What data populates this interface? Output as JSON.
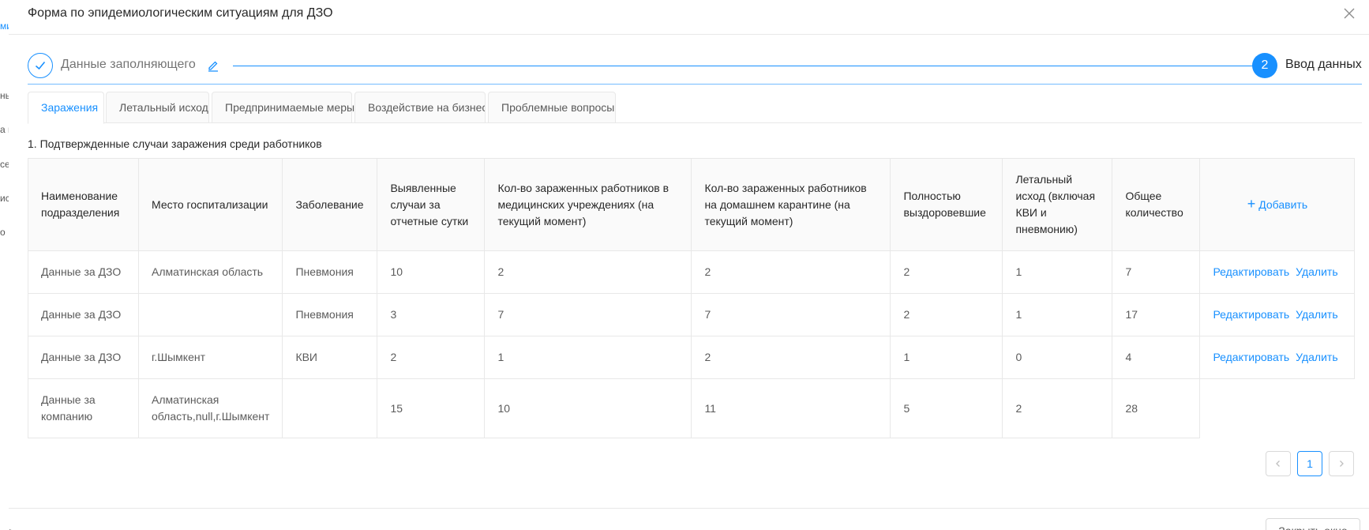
{
  "background_fragments": [
    "ми",
    "нь",
    "а п",
    "се",
    "ис",
    "о"
  ],
  "modal": {
    "title": "Форма по эпидемиологическим ситуациям для ДЗО",
    "close_icon": "close-icon"
  },
  "steps": [
    {
      "label": "Данные заполняющего",
      "status": "finished",
      "icon": "check-icon"
    },
    {
      "number": "2",
      "label": "Ввод данных",
      "status": "active"
    }
  ],
  "tabs": [
    {
      "label": "Заражения",
      "active": true
    },
    {
      "label": "Летальный исход",
      "active": false
    },
    {
      "label": "Предпринимаемые меры",
      "active": false
    },
    {
      "label": "Воздействие на бизнес",
      "active": false
    },
    {
      "label": "Проблемные вопросы",
      "active": false
    }
  ],
  "section_title": "1. Подтвержденные случаи заражения среди работников",
  "table": {
    "columns": [
      "Наименование подразделения",
      "Место госпитализации",
      "Заболевание",
      "Выявленные случаи за отчетные сутки",
      "Кол-во зараженных работников в медицинских учреждениях (на текущий момент)",
      "Кол-во зараженных работников на домашнем карантине (на текущий момент)",
      "Полностью выздоровевшие",
      "Летальный исход (включая КВИ и пневмонию)",
      "Общее количество"
    ],
    "add_label": "Добавить",
    "edit_label": "Редактировать",
    "delete_label": "Удалить",
    "rows": [
      [
        "Данные за ДЗО",
        "Алматинская область",
        "Пневмония",
        "10",
        "2",
        "2",
        "2",
        "1",
        "7"
      ],
      [
        "Данные за ДЗО",
        "",
        "Пневмония",
        "3",
        "7",
        "7",
        "2",
        "1",
        "17"
      ],
      [
        "Данные за ДЗО",
        "г.Шымкент",
        "КВИ",
        "2",
        "1",
        "2",
        "1",
        "0",
        "4"
      ]
    ],
    "total_row": [
      "Данные за компанию",
      "Алматинская область,null,г.Шымкент",
      "",
      "15",
      "10",
      "11",
      "5",
      "2",
      "28"
    ]
  },
  "pagination": {
    "current": "1"
  },
  "footer": {
    "close_button": "Закрыть окно"
  },
  "colors": {
    "accent": "#1890ff",
    "border": "#e8e8e8",
    "header_bg": "#fafafa"
  }
}
